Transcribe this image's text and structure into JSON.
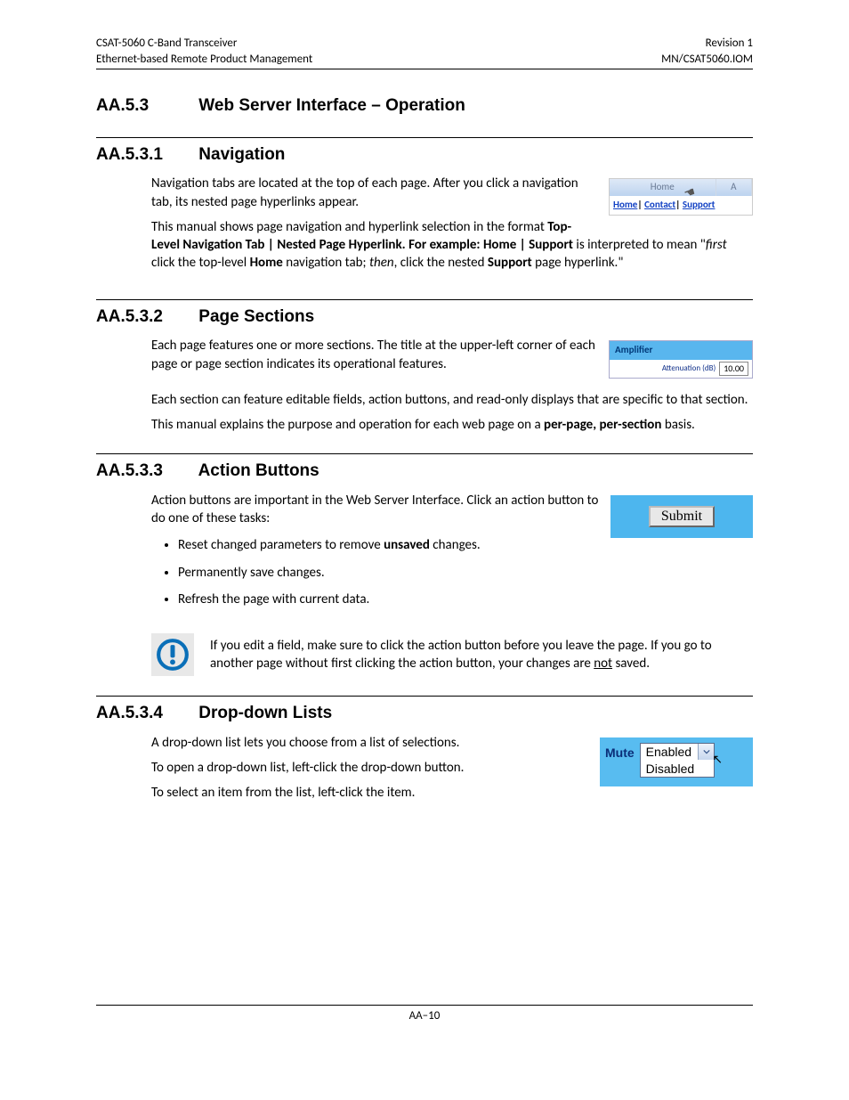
{
  "header": {
    "left_line1": "CSAT-5060 C-Band Transceiver",
    "left_line2": "Ethernet-based Remote Product Management",
    "right_line1": "Revision 1",
    "right_line2": "MN/CSAT5060.IOM"
  },
  "sec_main": {
    "num": "AA.5.3",
    "title": "Web Server Interface – Operation"
  },
  "sec_nav": {
    "num": "AA.5.3.1",
    "title": "Navigation",
    "p1": "Navigation tabs are located at the top of each page. After you click a navigation tab, its nested page hyperlinks appear.",
    "p2a": "This manual shows page navigation and hyperlink selection in the format ",
    "p2b_bold": "Top-Level Navigation Tab | Nested Page Hyperlink. For example: Home | Support",
    "p2c": " is interpreted to mean \"",
    "p2d_italic": "first",
    "p2e": " click the top-level ",
    "p2f_bold": "Home",
    "p2g": " navigation tab; ",
    "p2h_italic": "then",
    "p2i": ", click the nested ",
    "p2j_bold": "Support",
    "p2k": " page hyperlink.\"",
    "mini": {
      "tab_home": "Home",
      "tab_a": "A",
      "link_home": "Home",
      "link_contact": "Contact",
      "link_support": "Support"
    }
  },
  "sec_ps": {
    "num": "AA.5.3.2",
    "title": "Page Sections",
    "p1": "Each page features one or more sections. The title at the upper-left corner of each page or page section indicates its operational features.",
    "p2": "Each section can feature editable fields, action buttons, and read-only displays that are specific to that section.",
    "p3a": "This manual explains the purpose and operation for each web page on a ",
    "p3b_bold": "per-page, per-section",
    "p3c": " basis.",
    "mini": {
      "header": "Amplifier",
      "label": "Attenuation (dB)",
      "value": "10.00"
    }
  },
  "sec_ab": {
    "num": "AA.5.3.3",
    "title": "Action Buttons",
    "p1": "Action buttons are important in the Web Server Interface. Click an action button to do one of these tasks:",
    "li1a": "Reset changed parameters to remove ",
    "li1b_bold": "unsaved",
    "li1c": " changes.",
    "li2": "Permanently save changes.",
    "li3": "Refresh the page with current data.",
    "mini": {
      "submit": "Submit"
    },
    "warn_a": "If you edit a field, make sure to click the action button before you leave the page. If you go to another page without first clicking the action button, your changes are ",
    "warn_u": "not",
    "warn_b": " saved."
  },
  "sec_dd": {
    "num": "AA.5.3.4",
    "title": "Drop-down Lists",
    "p1": "A drop-down list lets you choose from a list of selections.",
    "p2": "To open a drop-down list, left-click the drop-down button.",
    "p3": "To select an item from the list, left-click the item.",
    "mini": {
      "label": "Mute",
      "opt1": "Enabled",
      "opt2": "Disabled"
    }
  },
  "footer": "AA–10"
}
